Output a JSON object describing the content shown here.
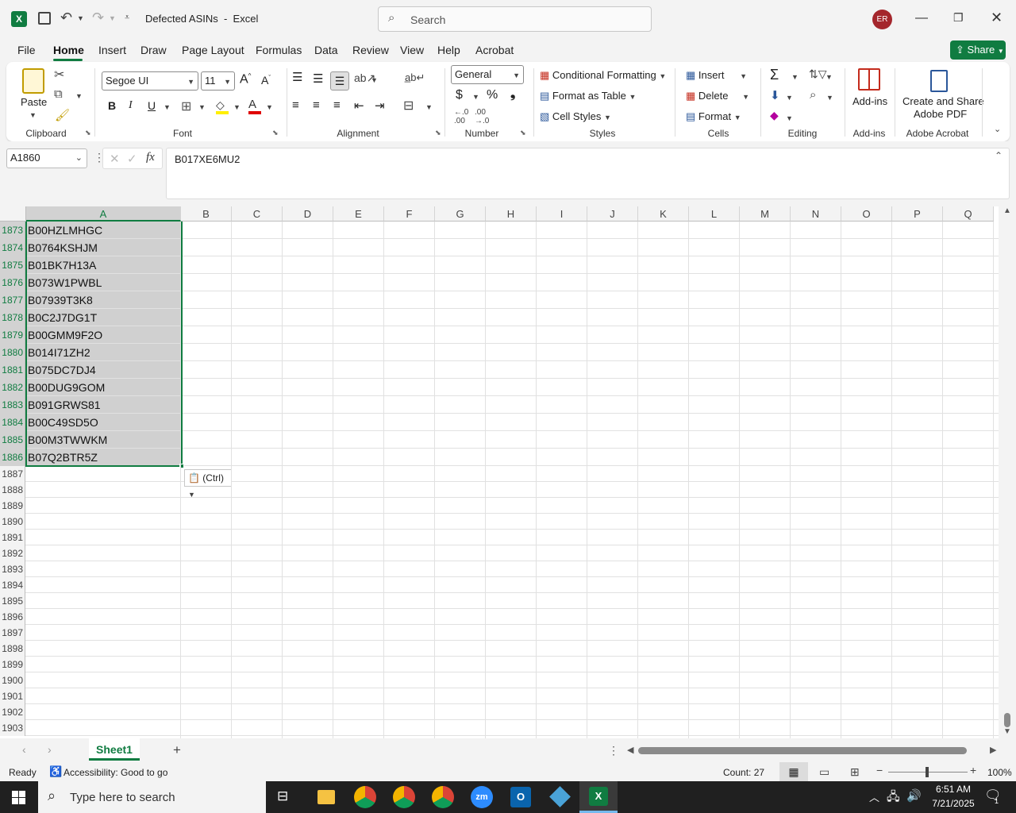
{
  "window": {
    "title": "Defected ASINs  -  Excel",
    "search_placeholder": "Search",
    "avatar_initials": "ER"
  },
  "ribbon_tabs": [
    "File",
    "Home",
    "Insert",
    "Draw",
    "Page Layout",
    "Formulas",
    "Data",
    "Review",
    "View",
    "Help",
    "Acrobat"
  ],
  "active_tab": "Home",
  "share_label": "Share",
  "ribbon": {
    "clipboard": {
      "paste": "Paste",
      "label": "Clipboard"
    },
    "font": {
      "name": "Segoe UI",
      "size": "11",
      "label": "Font",
      "bold": "B",
      "italic": "I",
      "underline": "U"
    },
    "alignment": {
      "label": "Alignment"
    },
    "number": {
      "format": "General",
      "label": "Number"
    },
    "styles": {
      "cond": "Conditional Formatting",
      "table": "Format as Table",
      "cell": "Cell Styles",
      "label": "Styles"
    },
    "cells": {
      "insert": "Insert",
      "delete": "Delete",
      "format": "Format",
      "label": "Cells"
    },
    "editing": {
      "label": "Editing"
    },
    "addins": {
      "btn": "Add-ins",
      "label": "Add-ins"
    },
    "acrobat": {
      "btn1": "Create and Share",
      "btn2": "Adobe PDF",
      "label": "Adobe Acrobat"
    }
  },
  "formula_bar": {
    "name_box": "A1860",
    "fx": "fx",
    "value": "B017XE6MU2"
  },
  "columns": [
    "A",
    "B",
    "C",
    "D",
    "E",
    "F",
    "G",
    "H",
    "I",
    "J",
    "K",
    "L",
    "M",
    "N",
    "O",
    "P",
    "Q"
  ],
  "rows": [
    {
      "n": "1873",
      "a": "B00HZLMHGC"
    },
    {
      "n": "1874",
      "a": "B0764KSHJM"
    },
    {
      "n": "1875",
      "a": "B01BK7H13A"
    },
    {
      "n": "1876",
      "a": "B073W1PWBL"
    },
    {
      "n": "1877",
      "a": "B07939T3K8"
    },
    {
      "n": "1878",
      "a": "B0C2J7DG1T"
    },
    {
      "n": "1879",
      "a": "B00GMM9F2O"
    },
    {
      "n": "1880",
      "a": "B014I71ZH2"
    },
    {
      "n": "1881",
      "a": "B075DC7DJ4"
    },
    {
      "n": "1882",
      "a": "B00DUG9GOM"
    },
    {
      "n": "1883",
      "a": "B091GRWS81"
    },
    {
      "n": "1884",
      "a": "B00C49SD5O"
    },
    {
      "n": "1885",
      "a": "B00M3TWWKM"
    },
    {
      "n": "1886",
      "a": "B07Q2BTR5Z"
    }
  ],
  "empty_rows": [
    "1887",
    "1888",
    "1889",
    "1890",
    "1891",
    "1892",
    "1893",
    "1894",
    "1895",
    "1896",
    "1897",
    "1898",
    "1899",
    "1900",
    "1901",
    "1902",
    "1903"
  ],
  "paste_options": "(Ctrl)",
  "sheet_tab": "Sheet1",
  "status": {
    "ready": "Ready",
    "accessibility": "Accessibility: Good to go",
    "count": "Count: 27",
    "zoom": "100%"
  },
  "taskbar": {
    "search_placeholder": "Type here to search",
    "time": "6:51 AM",
    "date": "7/21/2025",
    "notif_count": "1"
  }
}
